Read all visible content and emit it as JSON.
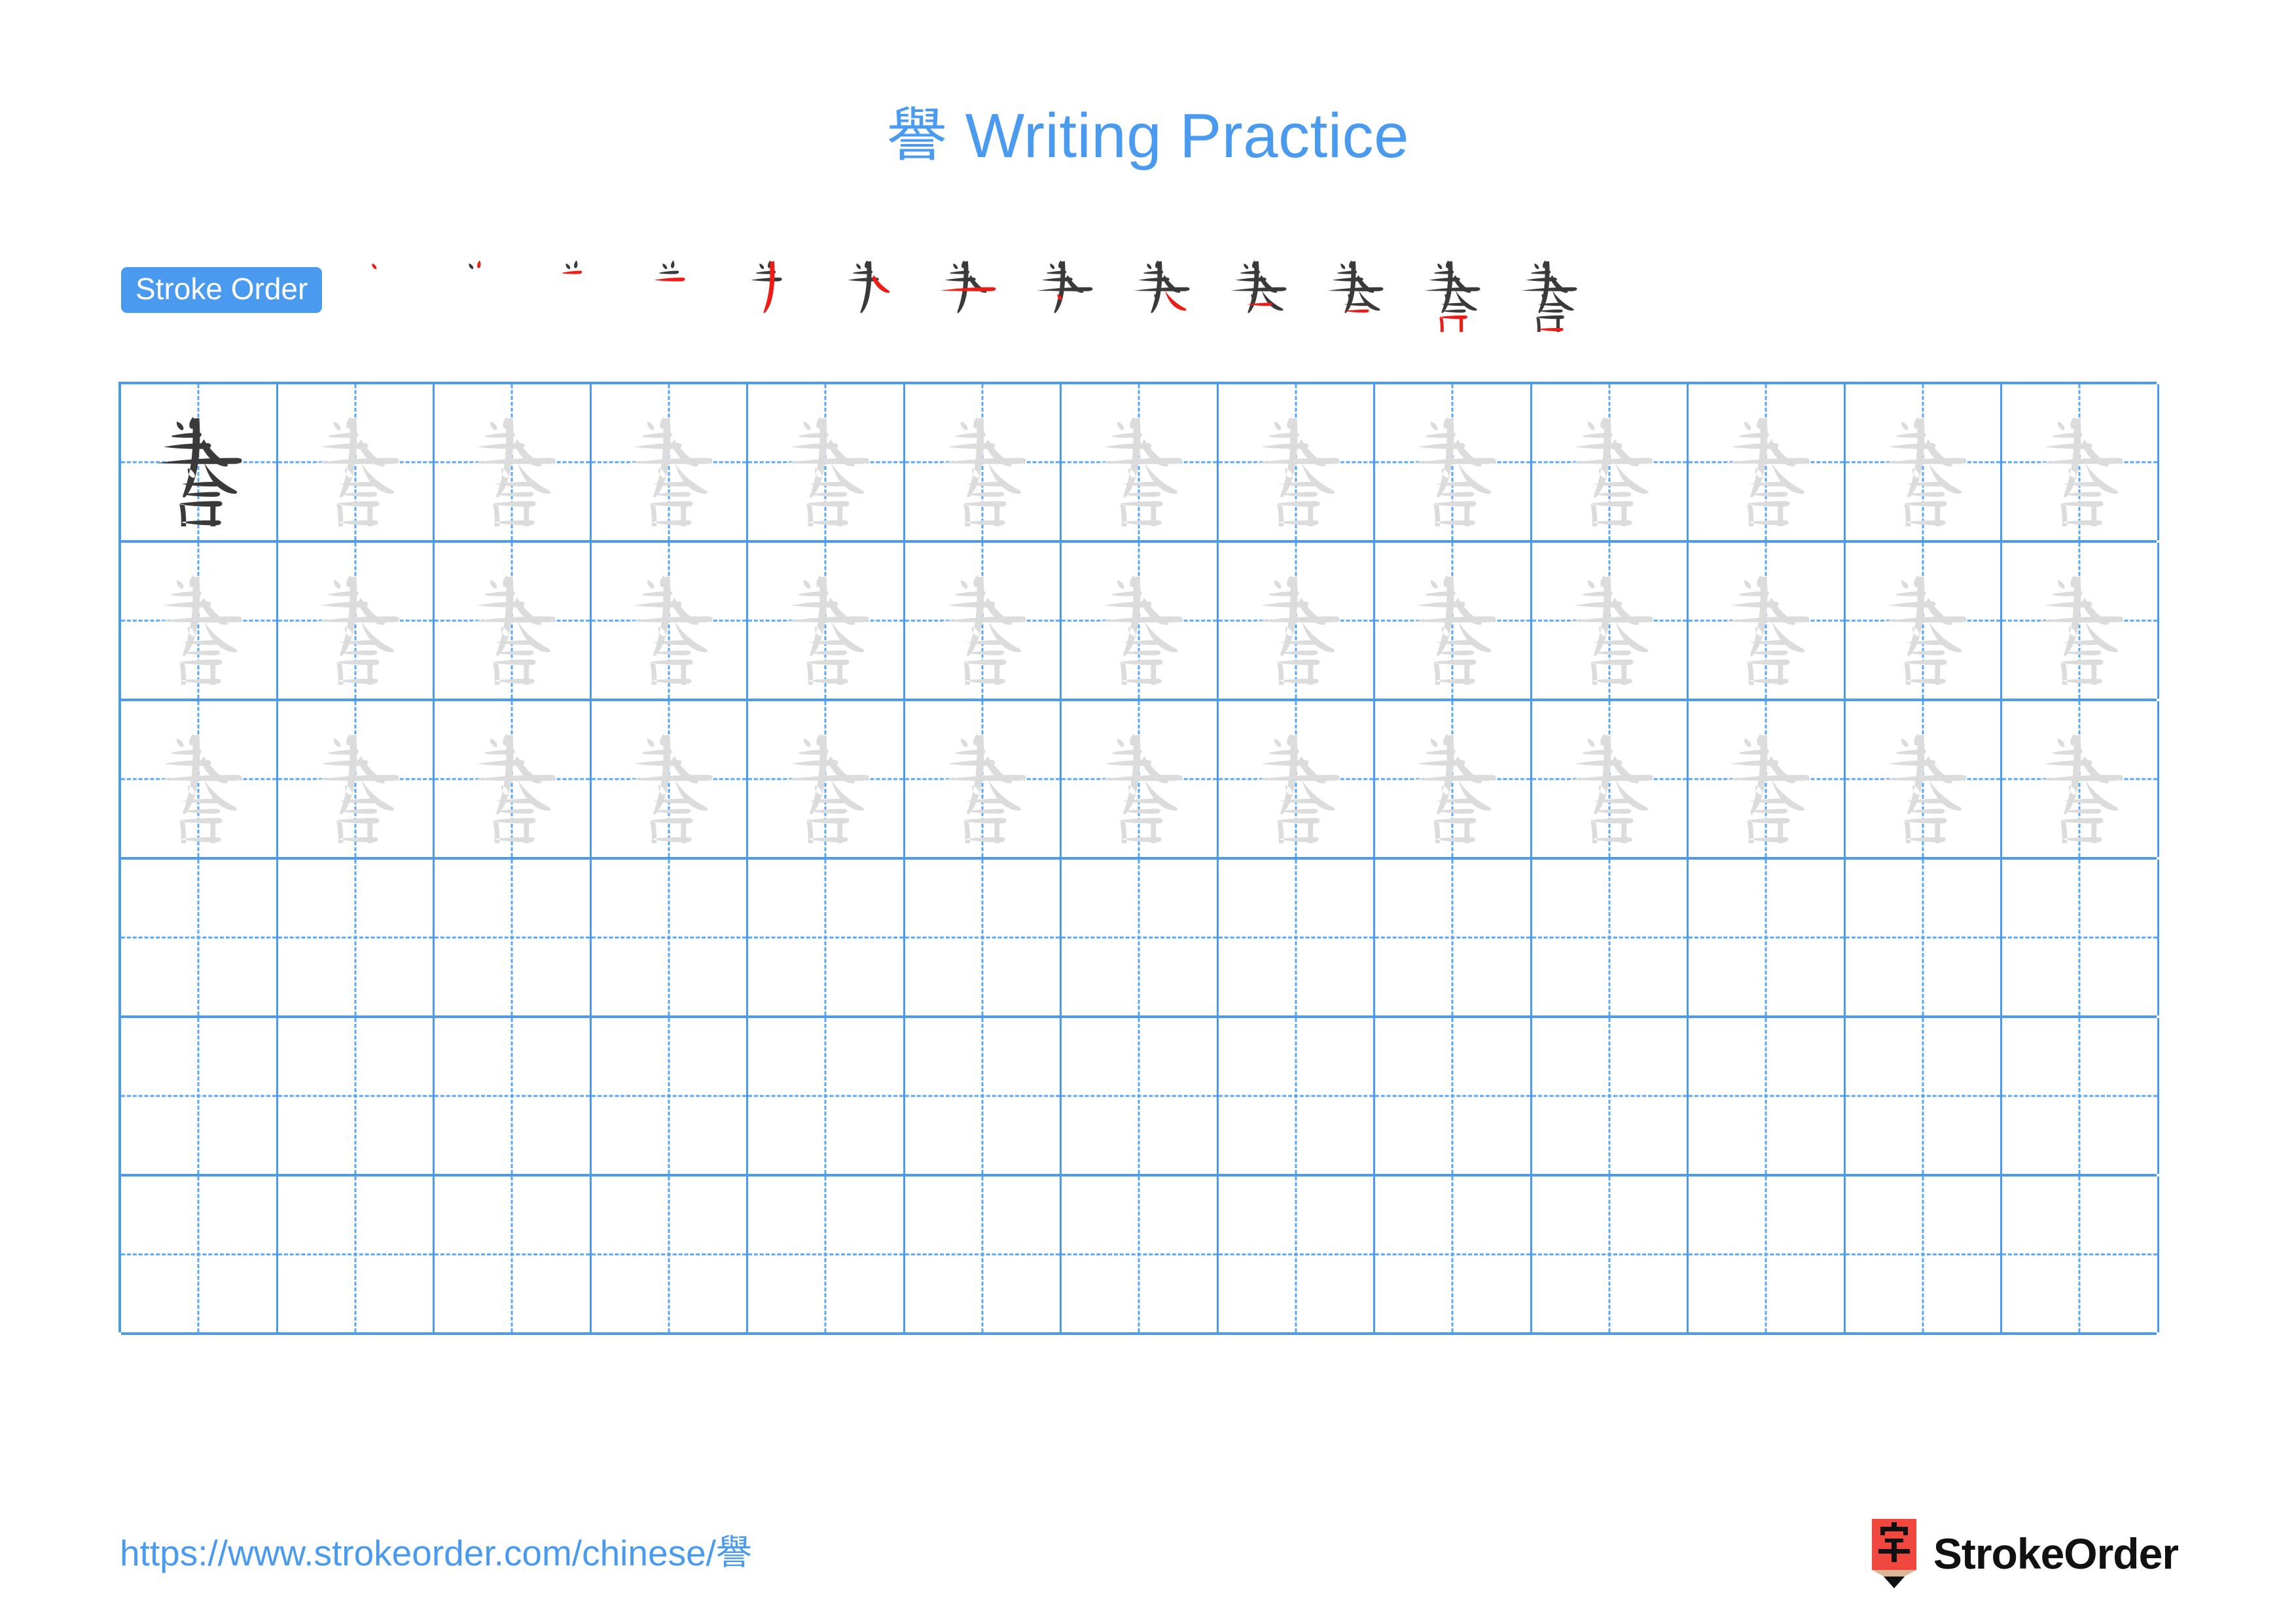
{
  "document": {
    "character": "譽",
    "title_text": "Writing Practice",
    "title_full": "譽 Writing Practice",
    "title_color": "#4a9bf0"
  },
  "stroke_order": {
    "badge_label": "Stroke Order",
    "badge_bg": "#4a9bf0",
    "badge_fg": "#ffffff",
    "stroke_count": 13,
    "new_stroke_color": "#ee1c17",
    "completed_stroke_color": "#3a3a3a",
    "steps": [
      {
        "index": 1,
        "name": "stroke-step-1",
        "strokes_shown": 1
      },
      {
        "index": 2,
        "name": "stroke-step-2",
        "strokes_shown": 2
      },
      {
        "index": 3,
        "name": "stroke-step-3",
        "strokes_shown": 3
      },
      {
        "index": 4,
        "name": "stroke-step-4",
        "strokes_shown": 4
      },
      {
        "index": 5,
        "name": "stroke-step-5",
        "strokes_shown": 5
      },
      {
        "index": 6,
        "name": "stroke-step-6",
        "strokes_shown": 6
      },
      {
        "index": 7,
        "name": "stroke-step-7",
        "strokes_shown": 7
      },
      {
        "index": 8,
        "name": "stroke-step-8",
        "strokes_shown": 8
      },
      {
        "index": 9,
        "name": "stroke-step-9",
        "strokes_shown": 9
      },
      {
        "index": 10,
        "name": "stroke-step-10",
        "strokes_shown": 10
      },
      {
        "index": 11,
        "name": "stroke-step-11",
        "strokes_shown": 11
      },
      {
        "index": 12,
        "name": "stroke-step-12",
        "strokes_shown": 12
      },
      {
        "index": 13,
        "name": "stroke-step-13",
        "strokes_shown": 13
      }
    ]
  },
  "practice_grid": {
    "columns": 13,
    "rows": 6,
    "grid_line_color": "#4a9bf0",
    "guide_line_color": "#5aa7f5",
    "dark_char_color": "#3a3a3a",
    "trace_char_color": "#dcdcdc",
    "row_contents": [
      {
        "row": 1,
        "cells": [
          "dark",
          "trace",
          "trace",
          "trace",
          "trace",
          "trace",
          "trace",
          "trace",
          "trace",
          "trace",
          "trace",
          "trace",
          "trace"
        ]
      },
      {
        "row": 2,
        "cells": [
          "trace",
          "trace",
          "trace",
          "trace",
          "trace",
          "trace",
          "trace",
          "trace",
          "trace",
          "trace",
          "trace",
          "trace",
          "trace"
        ]
      },
      {
        "row": 3,
        "cells": [
          "trace",
          "trace",
          "trace",
          "trace",
          "trace",
          "trace",
          "trace",
          "trace",
          "trace",
          "trace",
          "trace",
          "trace",
          "trace"
        ]
      },
      {
        "row": 4,
        "cells": [
          "empty",
          "empty",
          "empty",
          "empty",
          "empty",
          "empty",
          "empty",
          "empty",
          "empty",
          "empty",
          "empty",
          "empty",
          "empty"
        ]
      },
      {
        "row": 5,
        "cells": [
          "empty",
          "empty",
          "empty",
          "empty",
          "empty",
          "empty",
          "empty",
          "empty",
          "empty",
          "empty",
          "empty",
          "empty",
          "empty"
        ]
      },
      {
        "row": 6,
        "cells": [
          "empty",
          "empty",
          "empty",
          "empty",
          "empty",
          "empty",
          "empty",
          "empty",
          "empty",
          "empty",
          "empty",
          "empty",
          "empty"
        ]
      }
    ]
  },
  "footer": {
    "url": "https://www.strokeorder.com/chinese/譽",
    "url_color": "#4a9bf0",
    "logo_text": "StrokeOrder",
    "logo_char": "字",
    "logo_body_color": "#f0483f",
    "logo_tip_color": "#dcb694",
    "logo_point_color": "#111111"
  }
}
